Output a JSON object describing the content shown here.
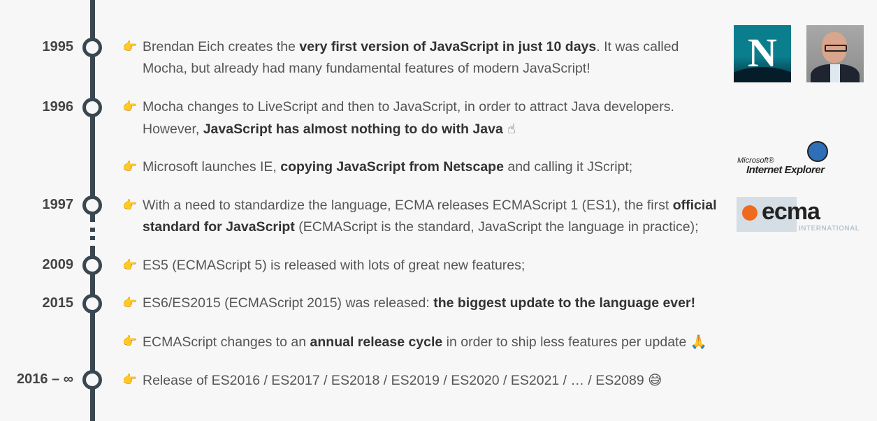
{
  "years": {
    "y1995": "1995",
    "y1996": "1996",
    "y1997": "1997",
    "y2009": "2009",
    "y2015": "2015",
    "y2016": "2016 – ∞"
  },
  "pointer_icon": "👉",
  "entries": {
    "e1995": {
      "pre": "Brendan Eich creates the ",
      "bold": "very first version of JavaScript in just 10 days",
      "post": ". It was called Mocha, but already had many fundamental features of modern JavaScript!"
    },
    "e1996a": {
      "pre": "Mocha changes to LiveScript and then to JavaScript, in order to attract Java developers. However, ",
      "bold": "JavaScript has almost nothing to do with Java",
      "emoji": " ☝"
    },
    "e1996b": {
      "pre": "Microsoft launches IE, ",
      "bold": "copying JavaScript from Netscape",
      "post": " and calling it JScript;"
    },
    "e1997": {
      "pre": "With a need to standardize the language, ECMA releases ECMAScript 1 (ES1), the first ",
      "bold": "official standard for JavaScript",
      "post": " (ECMAScript is the standard, JavaScript the language in practice);"
    },
    "e2009": {
      "text": "ES5 (ECMAScript 5) is released with lots of great new features;"
    },
    "e2015a": {
      "pre": "ES6/ES2015 (ECMAScript 2015) was released: ",
      "bold": "the biggest update to the language ever!"
    },
    "e2015b": {
      "pre": "ECMAScript changes to an ",
      "bold": "annual release cycle",
      "post": " in order to ship less features per update ",
      "emoji": "🙏"
    },
    "e2016": {
      "pre": "Release of ES2016 / ES2017 / ES2018 / ES2019 / ES2020 / ES2021 / … / ES2089 ",
      "emoji": "😅"
    }
  },
  "logos": {
    "netscape_letter": "N",
    "ie_brand": "Microsoft®",
    "ie_name": "Internet Explorer",
    "ecma_word": "ecma",
    "ecma_sub": "INTERNATIONAL"
  },
  "colors": {
    "timeline": "#3a4750",
    "pointer": "#e0a419"
  }
}
